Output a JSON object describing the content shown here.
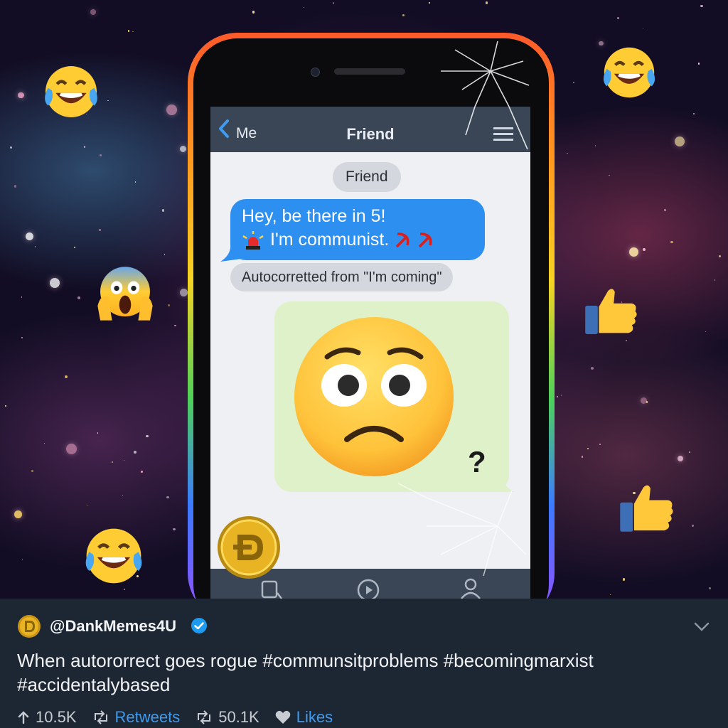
{
  "chat": {
    "back_label": "Me",
    "title": "Friend",
    "sender_pill": "Friend",
    "message_line1": "Hey, be there in 5!",
    "message_line2": "I'm communist.",
    "autocorrect_note": "Autocorretted from \"I'm coming\"",
    "reply_mark": "?"
  },
  "tweet": {
    "handle": "@DankMemes4U",
    "text_line1": "When autororrect goes rogue #communsitproblems #becomingmarxist",
    "text_line2": "#accidentalybased",
    "upvotes": "10.5K",
    "retweets_label": "Retweets",
    "retweet_count": "50.1K",
    "likes_label": "Likes"
  },
  "icons": {
    "back": "chevron-left-icon",
    "menu": "hamburger-menu-icon",
    "siren": "siren-icon",
    "hammer_sickle": "hammer-sickle-icon",
    "worried_face": "worried-face-icon",
    "coin": "dogecoin-icon",
    "laughing": "tears-of-joy-emoji",
    "screaming": "screaming-face-emoji",
    "thumbs_up": "thumbs-up-emoji",
    "verified": "verified-badge-icon",
    "chevron_down": "chevron-down-icon",
    "upvote": "arrow-up-icon",
    "retweet": "retweet-icon",
    "like": "heart-icon"
  },
  "colors": {
    "message_blue": "#2d8ff0",
    "reply_green": "#dff1c9",
    "tweet_panel": "#1d2633",
    "link_blue": "#3f9bf0",
    "verified_blue": "#1d9bf0"
  }
}
